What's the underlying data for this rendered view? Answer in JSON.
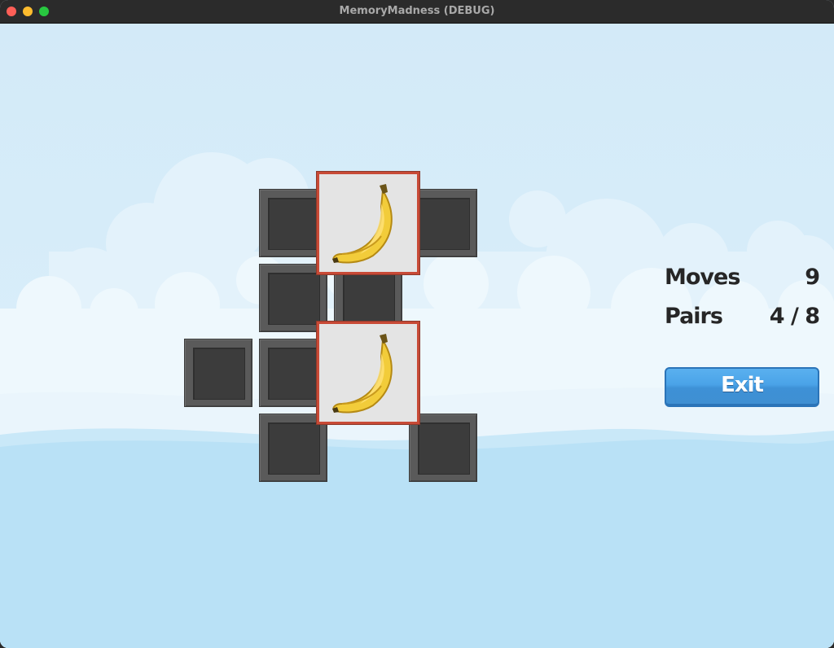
{
  "window": {
    "title": "MemoryMadness (DEBUG)"
  },
  "hud": {
    "moves_label": "Moves",
    "moves_value": "9",
    "pairs_label": "Pairs",
    "pairs_value": "4 / 8"
  },
  "exit_button": {
    "label": "Exit"
  },
  "board": {
    "face_up_cards": [
      {
        "icon": "banana-icon"
      },
      {
        "icon": "banana-icon"
      }
    ],
    "face_down_count": 10
  },
  "colors": {
    "sky": "#d6ecf8",
    "card_back": "#5a5a5a",
    "card_highlight_border": "#c84a36",
    "exit_button": "#4aa3e8"
  }
}
